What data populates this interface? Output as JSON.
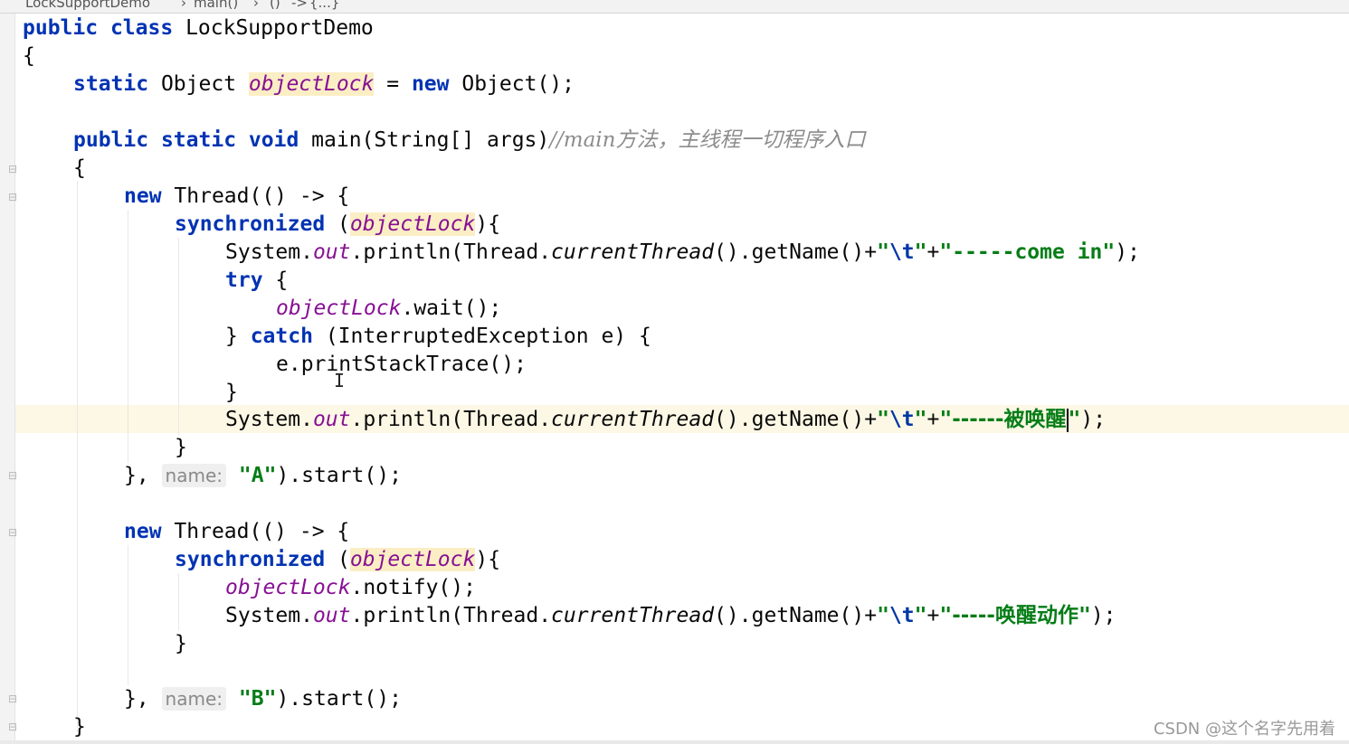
{
  "breadcrumb": {
    "items": [
      "LockSupportDemo",
      "main()",
      "()",
      "->",
      "{...}"
    ]
  },
  "code": {
    "kw_public": "public",
    "kw_class": "class",
    "kw_static": "static",
    "kw_void": "void",
    "kw_new": "new",
    "kw_synchronized": "synchronized",
    "kw_try": "try",
    "kw_catch": "catch",
    "class_name": "LockSupportDemo",
    "type_object": "Object",
    "field_objectLock": "objectLock",
    "main_signature": "main(String[] args)",
    "comment_main": "//main方法，主线程一切程序入口",
    "thread_ctor": "Thread(() -> {",
    "sys_prefix": "System.",
    "out_field": "out",
    "println_open": ".println(Thread.",
    "current_thread": "currentThread",
    "get_name": "().getName()+",
    "str_tab_escape": "\\t",
    "str_come_in": "-----come in",
    "str_woken": "------被唤醒",
    "str_wake_action": "-----唤醒动作",
    "wait_call": ".wait();",
    "notify_call": ".notify();",
    "catch_params": "(InterruptedException e) {",
    "print_stack": "e.printStackTrace();",
    "param_hint_name": "name:",
    "thread_name_a": "A",
    "thread_name_b": "B",
    "start_call": ").start();"
  },
  "watermark": "CSDN @这个名字先用着",
  "colors": {
    "keyword": "#0033b3",
    "field": "#871094",
    "string": "#067d17",
    "comment": "#8c8c8c",
    "current_line": "#fcf8e5",
    "field_highlight": "#fbeec4"
  },
  "icons": {
    "fold_marker": "fold-marker-icon",
    "text_cursor": "text-cursor-icon"
  }
}
